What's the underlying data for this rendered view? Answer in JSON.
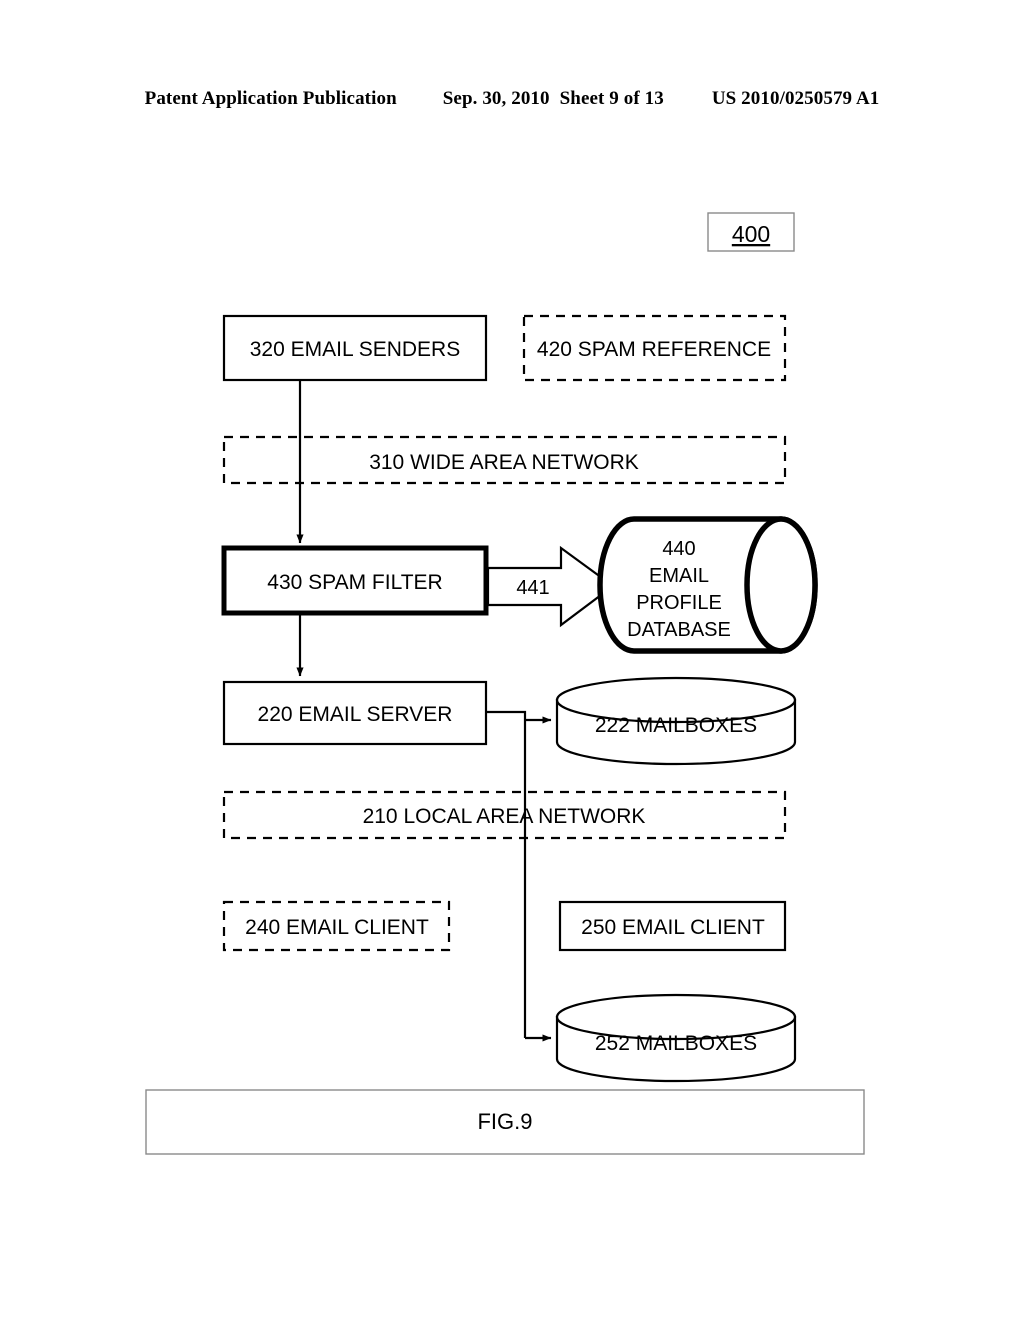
{
  "header": {
    "publication": "Patent Application Publication",
    "date": "Sep. 30, 2010",
    "sheet": "Sheet 9 of 13",
    "patent_number": "US 2010/0250579 A1"
  },
  "figure": {
    "reference_number": "400",
    "caption": "FIG.9"
  },
  "nodes": {
    "email_senders": "320 EMAIL SENDERS",
    "spam_reference": "420 SPAM REFERENCE",
    "wide_area_network": "310  WIDE  AREA NETWORK",
    "spam_filter": "430 SPAM FILTER",
    "email_profile_database": {
      "line1": "440",
      "line2": "EMAIL",
      "line3": "PROFILE",
      "line4": "DATABASE"
    },
    "email_server": "220 EMAIL SERVER",
    "mailboxes_222": "222 MAILBOXES",
    "local_area_network": "210   LOCAL  AREA NETWORK",
    "email_client_240": "240 EMAIL CLIENT",
    "email_client_250": "250 EMAIL CLIENT",
    "mailboxes_252": "252 MAILBOXES"
  },
  "connectors": {
    "spam_filter_to_database": "441"
  },
  "colors": {
    "ink": "#000000",
    "paper": "#ffffff",
    "thin_rule": "#8a8a8a"
  }
}
